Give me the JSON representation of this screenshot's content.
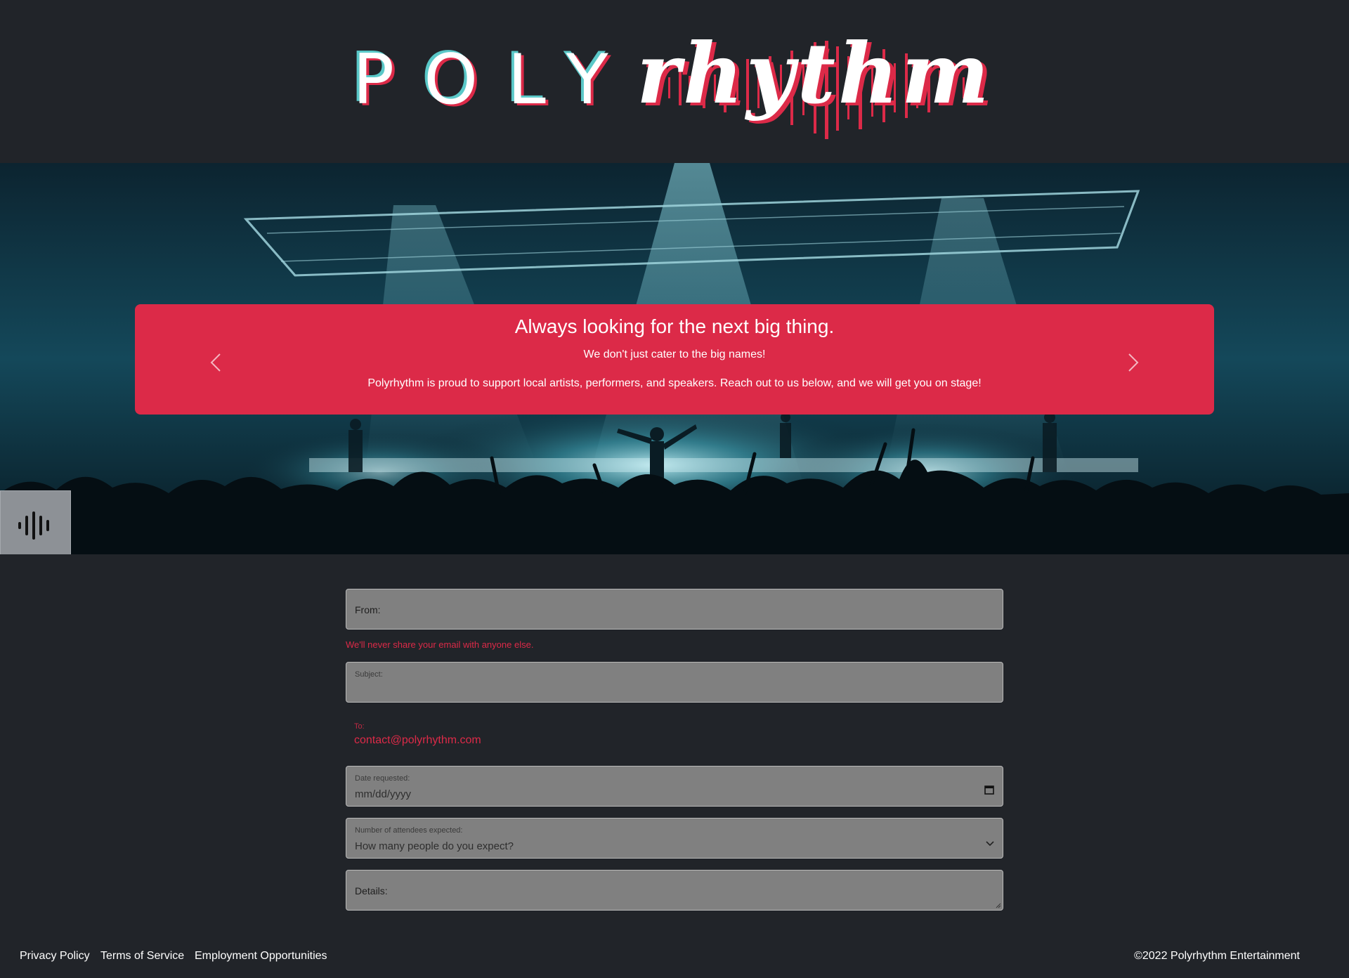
{
  "brand": {
    "logo_word1": "POLY",
    "logo_word2": "rhythm",
    "colors": {
      "accent": "#dc2a48",
      "teal": "#5ac8c8",
      "background": "#212429"
    }
  },
  "hero": {
    "title": "Always looking for the next big thing.",
    "line1": "We don't just cater to the big names!",
    "line2": "Polyrhythm is proud to support local artists, performers, and speakers. Reach out to us below, and we will get you on stage!",
    "prev_icon": "chevron-left-icon",
    "next_icon": "chevron-right-icon",
    "audio_icon": "soundwave-icon"
  },
  "form": {
    "from_label": "From:",
    "from_help": "We'll never share your email with anyone else.",
    "subject_label": "Subject:",
    "to_label": "To:",
    "to_value": "contact@polyrhythm.com",
    "date_label": "Date requested:",
    "date_placeholder": "mm/dd/yyyy",
    "attendees_label": "Number of attendees expected:",
    "attendees_value": "How many people do you expect?",
    "details_label": "Details:"
  },
  "footer": {
    "links": [
      "Privacy Policy",
      "Terms of Service",
      "Employment Opportunities"
    ],
    "copyright": "©2022 Polyrhythm Entertainment"
  }
}
